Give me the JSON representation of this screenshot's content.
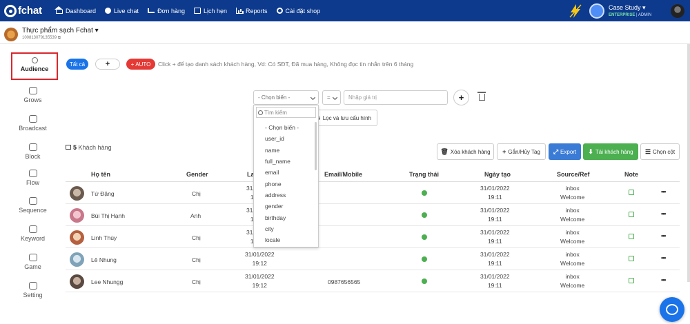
{
  "topbar": {
    "logo": "fchat",
    "nav": [
      {
        "label": "Dashboard",
        "icon": "home-icon"
      },
      {
        "label": "Live chat",
        "icon": "chat-icon"
      },
      {
        "label": "Đơn hàng",
        "icon": "cart-icon"
      },
      {
        "label": "Lịch hẹn",
        "icon": "calendar-icon"
      },
      {
        "label": "Reports",
        "icon": "bar-chart-icon"
      },
      {
        "label": "Cài đặt shop",
        "icon": "gear-icon"
      }
    ],
    "account_name": "Case Study",
    "account_plan": "ENTERPRISE",
    "account_role": "ADMIN"
  },
  "shop": {
    "name": "Thực phẩm sạch Fchat",
    "id": "100813079135539"
  },
  "sidebar": {
    "items": [
      {
        "label": "Audience",
        "icon": "user-icon"
      },
      {
        "label": "Grows",
        "icon": "grows-icon"
      },
      {
        "label": "Broadcast",
        "icon": "send-icon"
      },
      {
        "label": "Block",
        "icon": "block-icon"
      },
      {
        "label": "Flow",
        "icon": "flow-icon"
      },
      {
        "label": "Sequence",
        "icon": "calendar-check-icon"
      },
      {
        "label": "Keyword",
        "icon": "key-icon"
      },
      {
        "label": "Game",
        "icon": "gamepad-icon"
      },
      {
        "label": "Setting",
        "icon": "gear-icon"
      }
    ]
  },
  "filters": {
    "all": "Tất cả",
    "add": "+",
    "auto": "AUTO",
    "hint": "Click + để tạo danh sách khách hàng, Vd: Có SĐT, Đã mua hàng, Không đọc tin nhắn trên 6 tháng"
  },
  "builder": {
    "variable": "- Chọn biến -",
    "operator": "=",
    "value_placeholder": "Nhập giá trị",
    "save_label": "Lọc và lưu cấu hình",
    "search_placeholder": "Tìm kiếm",
    "options": [
      "- Chọn biến -",
      "user_id",
      "name",
      "full_name",
      "email",
      "phone",
      "address",
      "gender",
      "birthday",
      "city",
      "locale"
    ]
  },
  "customers": {
    "count": "5",
    "count_label": "Khách hàng",
    "buttons": {
      "delete": "Xóa khách hàng",
      "tag": "Gắn/Hủy Tag",
      "export": "Export",
      "download": "Tải khách hàng",
      "columns": "Chọn cột"
    },
    "columns": [
      "Họ tên",
      "Gender",
      "La",
      "Email/Mobile",
      "Trạng thái",
      "Ngày tạo",
      "Source/Ref",
      "Note"
    ],
    "rows": [
      {
        "name": "Tứ Đặng",
        "gender": "Chị",
        "last_date": "31/0",
        "last_time": "1",
        "email": "",
        "created_date": "31/01/2022",
        "created_time": "19:11",
        "source": "inbox",
        "ref": "Welcome"
      },
      {
        "name": "Bùi Thị Hạnh",
        "gender": "Anh",
        "last_date": "31/0",
        "last_time": "1",
        "email": "",
        "created_date": "31/01/2022",
        "created_time": "19:11",
        "source": "inbox",
        "ref": "Welcome"
      },
      {
        "name": "Linh Thùy",
        "gender": "Chị",
        "last_date": "31/0",
        "last_time": "1",
        "email": "",
        "created_date": "31/01/2022",
        "created_time": "19:11",
        "source": "inbox",
        "ref": "Welcome"
      },
      {
        "name": "Lê Nhung",
        "gender": "Chị",
        "last_date": "31/01/2022",
        "last_time": "19:12",
        "email": "",
        "created_date": "31/01/2022",
        "created_time": "19:11",
        "source": "inbox",
        "ref": "Welcome"
      },
      {
        "name": "Lee Nhungg",
        "gender": "Chị",
        "last_date": "31/01/2022",
        "last_time": "19:12",
        "email": "0987656565",
        "created_date": "31/01/2022",
        "created_time": "19:11",
        "source": "inbox",
        "ref": "Welcome"
      }
    ]
  },
  "colors": {
    "navbar": "#0d3a8c",
    "primary": "#1a73e8",
    "danger": "#e53935",
    "success": "#4caf50",
    "export": "#3a7bd5",
    "active_outline": "#d9262c"
  }
}
